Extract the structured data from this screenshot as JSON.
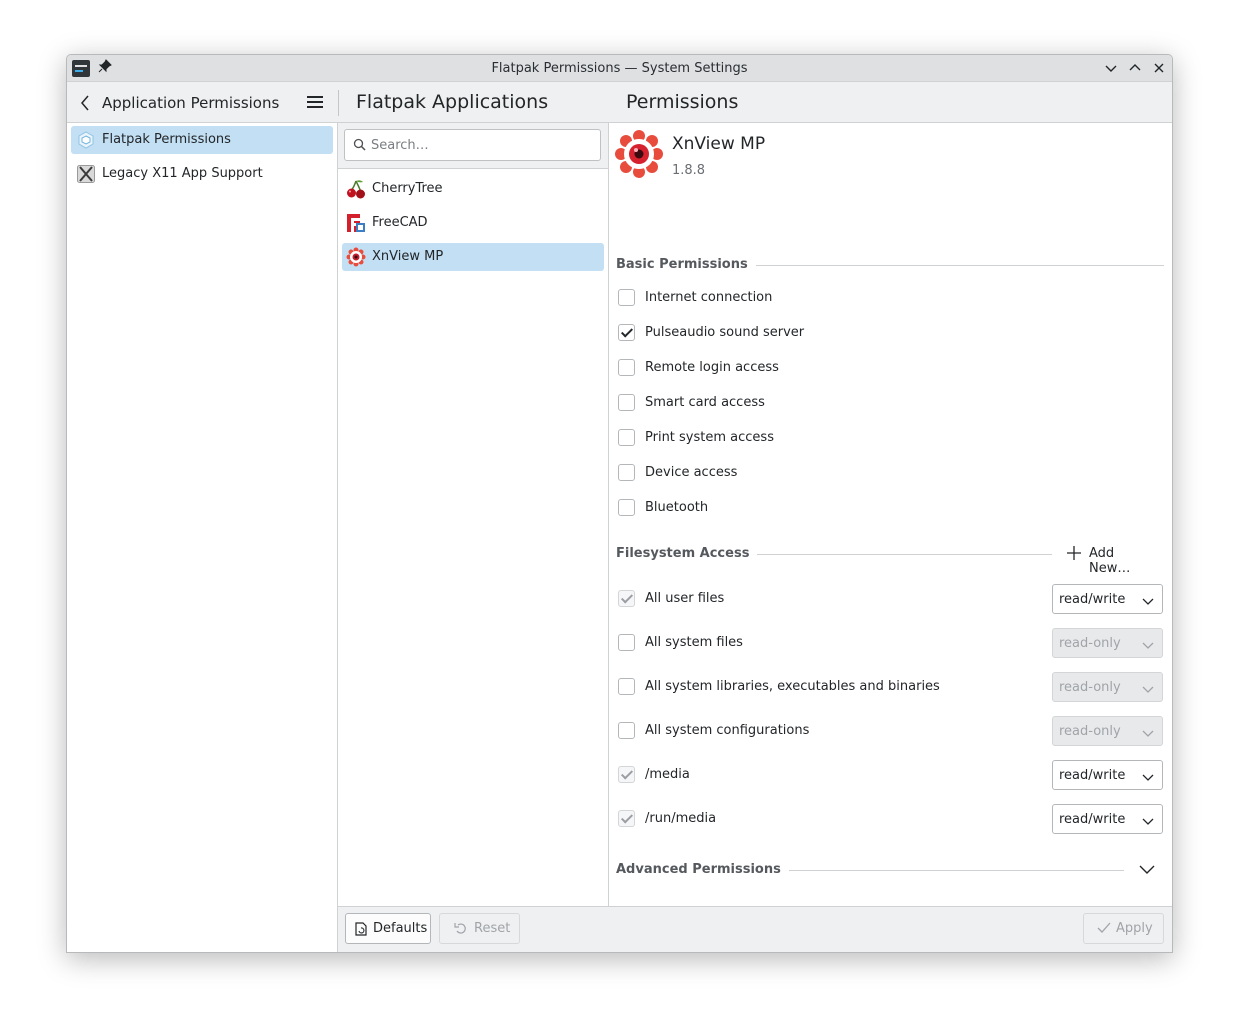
{
  "window": {
    "title": "Flatpak Permissions — System Settings"
  },
  "header": {
    "left_title": "Application Permissions",
    "middle_title": "Flatpak Applications",
    "right_title": "Permissions"
  },
  "sidebar": {
    "items": [
      {
        "label": "Flatpak Permissions",
        "icon": "flatpak-icon",
        "selected": true
      },
      {
        "label": "Legacy X11 App Support",
        "icon": "x11-icon",
        "selected": false
      }
    ]
  },
  "applications": {
    "search_placeholder": "Search…",
    "items": [
      {
        "label": "CherryTree",
        "icon": "cherry-icon",
        "selected": false
      },
      {
        "label": "FreeCAD",
        "icon": "freecad-icon",
        "selected": false
      },
      {
        "label": "XnView MP",
        "icon": "xnview-icon",
        "selected": true
      }
    ]
  },
  "app": {
    "name": "XnView MP",
    "version": "1.8.8"
  },
  "basic": {
    "title": "Basic Permissions",
    "items": [
      {
        "label": "Internet connection",
        "checked": false
      },
      {
        "label": "Pulseaudio sound server",
        "checked": true
      },
      {
        "label": "Remote login access",
        "checked": false
      },
      {
        "label": "Smart card access",
        "checked": false
      },
      {
        "label": "Print system access",
        "checked": false
      },
      {
        "label": "Device access",
        "checked": false
      },
      {
        "label": "Bluetooth",
        "checked": false
      }
    ]
  },
  "filesystem": {
    "title": "Filesystem Access",
    "add_label": "Add New…",
    "items": [
      {
        "label": "All user files",
        "checked": true,
        "mode": "read/write"
      },
      {
        "label": "All system files",
        "checked": false,
        "mode": "read-only"
      },
      {
        "label": "All system libraries, executables and binaries",
        "checked": false,
        "mode": "read-only"
      },
      {
        "label": "All system configurations",
        "checked": false,
        "mode": "read-only"
      },
      {
        "label": "/media",
        "checked": true,
        "mode": "read/write"
      },
      {
        "label": "/run/media",
        "checked": true,
        "mode": "read/write"
      }
    ]
  },
  "advanced": {
    "title": "Advanced Permissions"
  },
  "footer": {
    "defaults_label": "Defaults",
    "reset_label": "Reset",
    "apply_label": "Apply"
  }
}
